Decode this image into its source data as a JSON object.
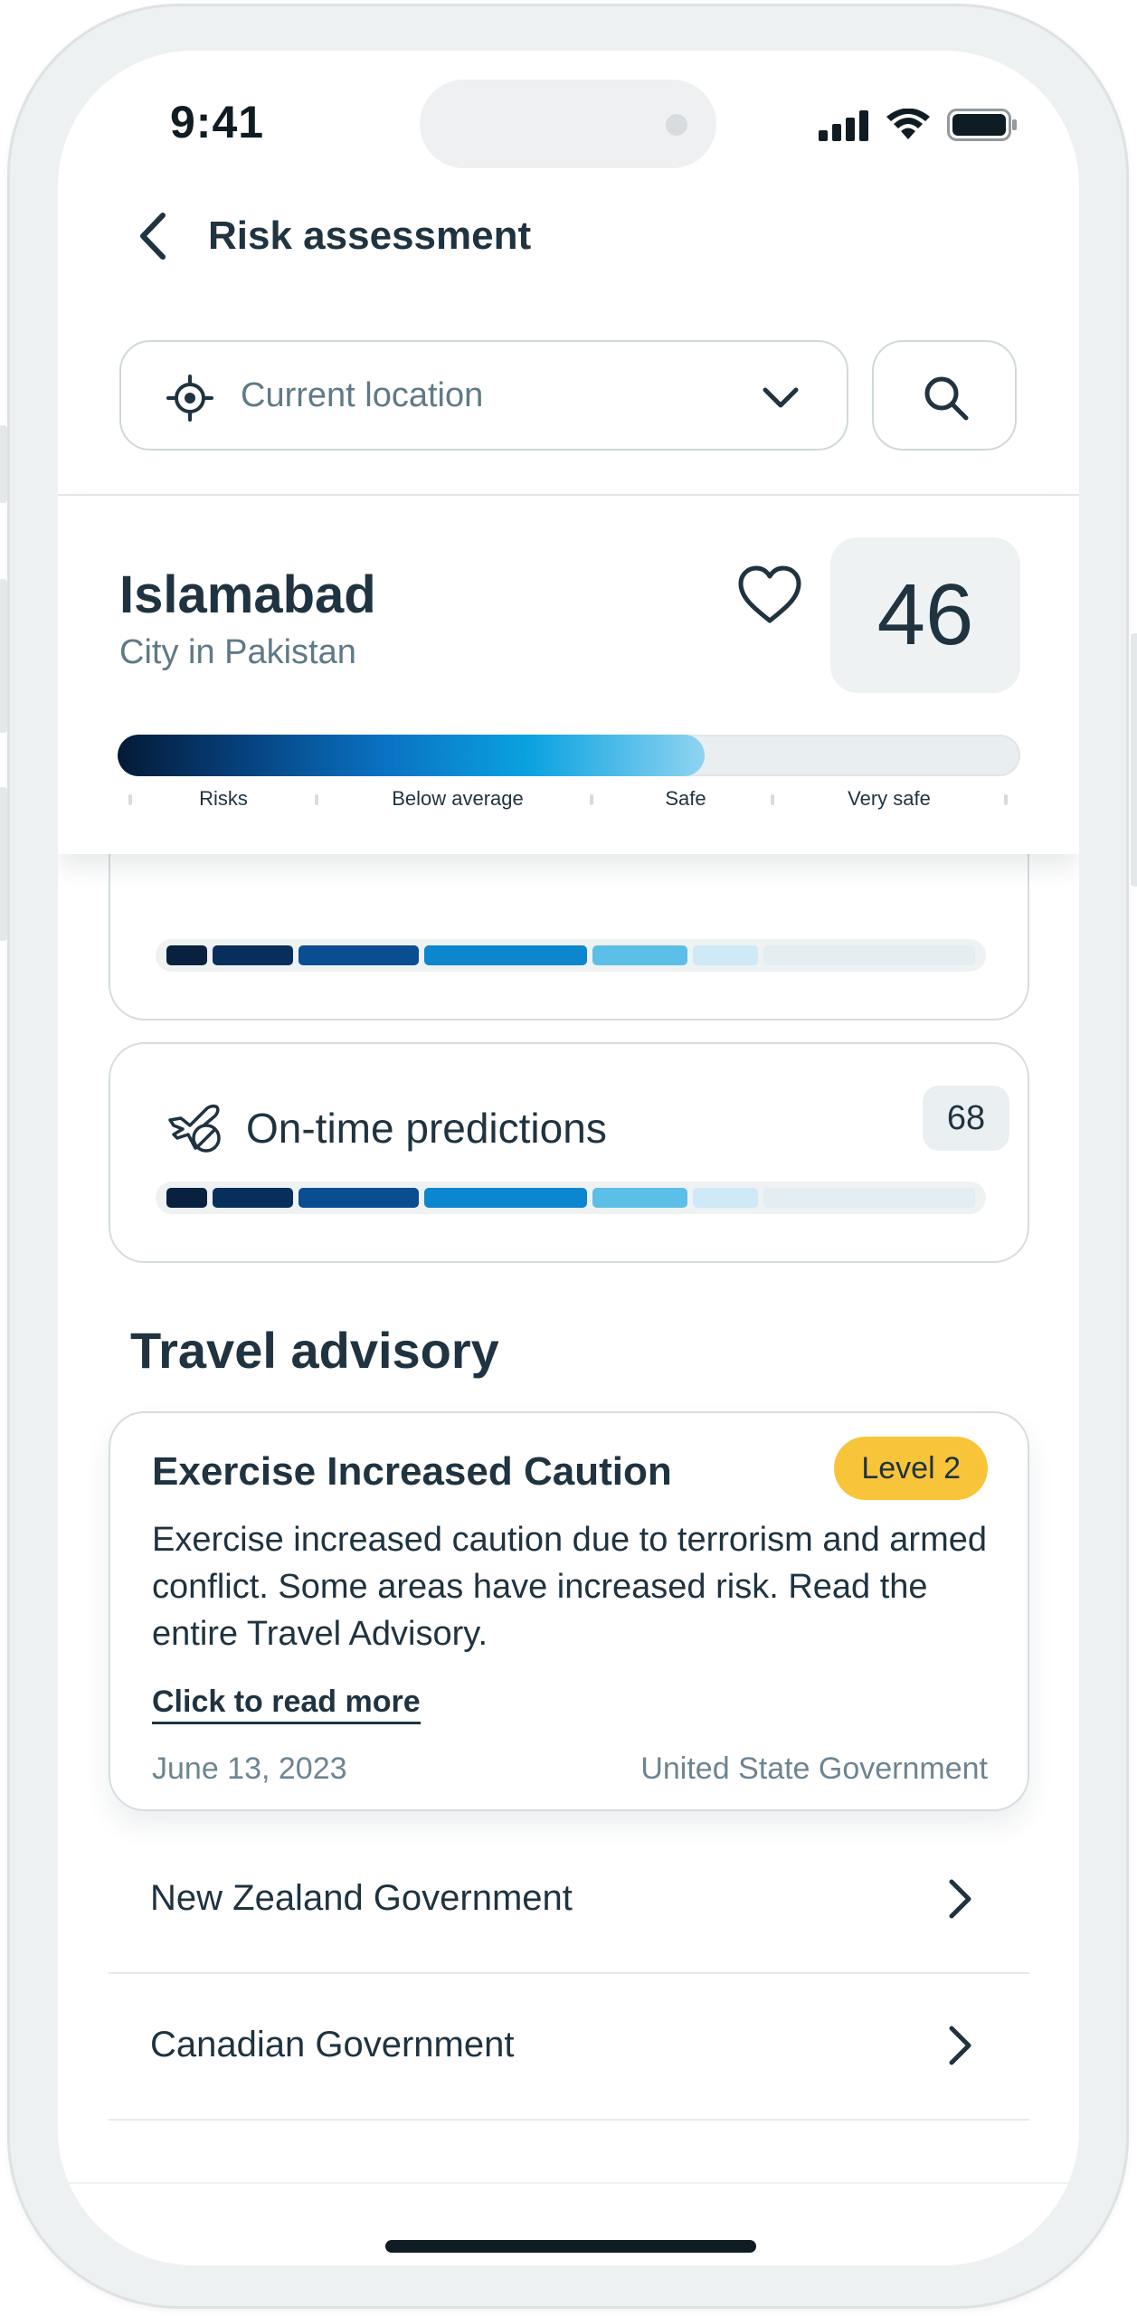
{
  "status_bar": {
    "time": "9:41"
  },
  "header": {
    "title": "Risk assessment"
  },
  "search": {
    "location_text": "Current location"
  },
  "city": {
    "name": "Islamabad",
    "subtitle": "City in Pakistan",
    "score": "46",
    "score_fraction": 0.65,
    "scale_labels": [
      "Risks",
      "Below average",
      "Safe",
      "Very safe"
    ]
  },
  "metrics": [
    {
      "label": "",
      "value": ""
    },
    {
      "label": "On-time predictions",
      "value": "68"
    }
  ],
  "segment_colors": [
    "#08213f",
    "#082f5c",
    "#0a4d93",
    "#0b86cf",
    "#5cbfe8",
    "#cfe9f6",
    "#e4edf1"
  ],
  "advisory": {
    "section_title": "Travel advisory",
    "card_title": "Exercise Increased Caution",
    "level": "Level 2",
    "body": "Exercise increased caution due to terrorism and armed conflict. Some areas have increased risk. Read the entire Travel Advisory.",
    "read_more": "Click to read more",
    "date": "June 13, 2023",
    "source": "United State Government"
  },
  "governments": [
    {
      "label": "New Zealand Government"
    },
    {
      "label": "Canadian Government"
    }
  ],
  "colors": {
    "accent": "#0a71c2",
    "badge_yellow": "#f8c439",
    "text": "#1f3340",
    "muted": "#5f7a87"
  }
}
